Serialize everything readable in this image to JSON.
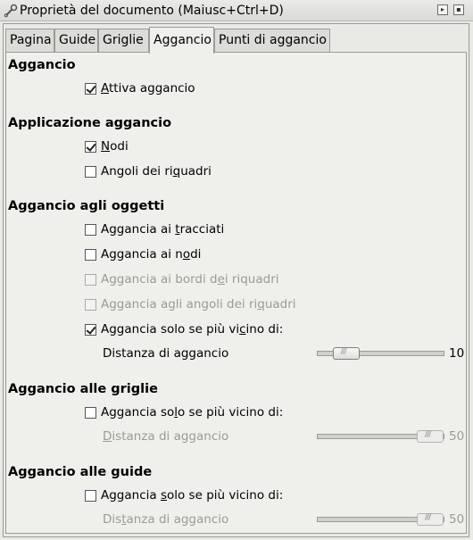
{
  "window": {
    "title": "Proprietà del documento (Maiusc+Ctrl+D)",
    "icon": "wrench-icon"
  },
  "tabs": [
    {
      "label": "Pagina",
      "active": false
    },
    {
      "label": "Guide",
      "active": false
    },
    {
      "label": "Griglie",
      "active": false
    },
    {
      "label": "Aggancio",
      "active": true
    },
    {
      "label": "Punti di aggancio",
      "active": false
    }
  ],
  "snapping": {
    "heading": "Aggancio",
    "enable": {
      "pre": "",
      "u": "A",
      "post": "ttiva aggancio",
      "checked": true
    }
  },
  "application": {
    "heading": "Applicazione aggancio",
    "nodes": {
      "pre": "",
      "u": "N",
      "post": "odi",
      "checked": true
    },
    "bbox_corners": {
      "pre": "Angoli dei ri",
      "u": "q",
      "post": "uadri",
      "checked": false
    }
  },
  "objects": {
    "heading": "Aggancio agli oggetti",
    "paths": {
      "pre": "Aggancia ai ",
      "u": "t",
      "post": "racciati",
      "checked": false,
      "enabled": true
    },
    "nodes": {
      "pre": "Aggancia ai n",
      "u": "o",
      "post": "di",
      "checked": false,
      "enabled": true
    },
    "bbox_edges": {
      "pre": "Aggancia ai bordi d",
      "u": "e",
      "post": "i riquadri",
      "checked": false,
      "enabled": false
    },
    "bbox_corners": {
      "pre": "Aggancia agli angoli dei ri",
      "u": "q",
      "post": "uadri",
      "checked": false,
      "enabled": false
    },
    "only_closer": {
      "pre": "Aggancia solo se più vi",
      "u": "c",
      "post": "ino di:",
      "checked": true,
      "enabled": true
    },
    "distance_label": "Distanza di aggancio",
    "distance_value": "10",
    "distance_fraction": 0.15,
    "distance_enabled": true
  },
  "grids": {
    "heading": "Aggancio alle griglie",
    "only_closer": {
      "pre": "Aggancia so",
      "u": "l",
      "post": "o se più vicino di:",
      "checked": false,
      "enabled": true
    },
    "distance_label": {
      "pre": "",
      "u": "D",
      "post": "istanza di aggancio"
    },
    "distance_value": "50",
    "distance_fraction": 1.0,
    "distance_enabled": false
  },
  "guides": {
    "heading": "Aggancio alle guide",
    "only_closer": {
      "pre": "Aggancia ",
      "u": "s",
      "post": "olo se più vicino di:",
      "checked": false,
      "enabled": true
    },
    "distance_label": {
      "pre": "Dis",
      "u": "t",
      "post": "anza di aggancio"
    },
    "distance_value": "50",
    "distance_fraction": 1.0,
    "distance_enabled": false
  }
}
